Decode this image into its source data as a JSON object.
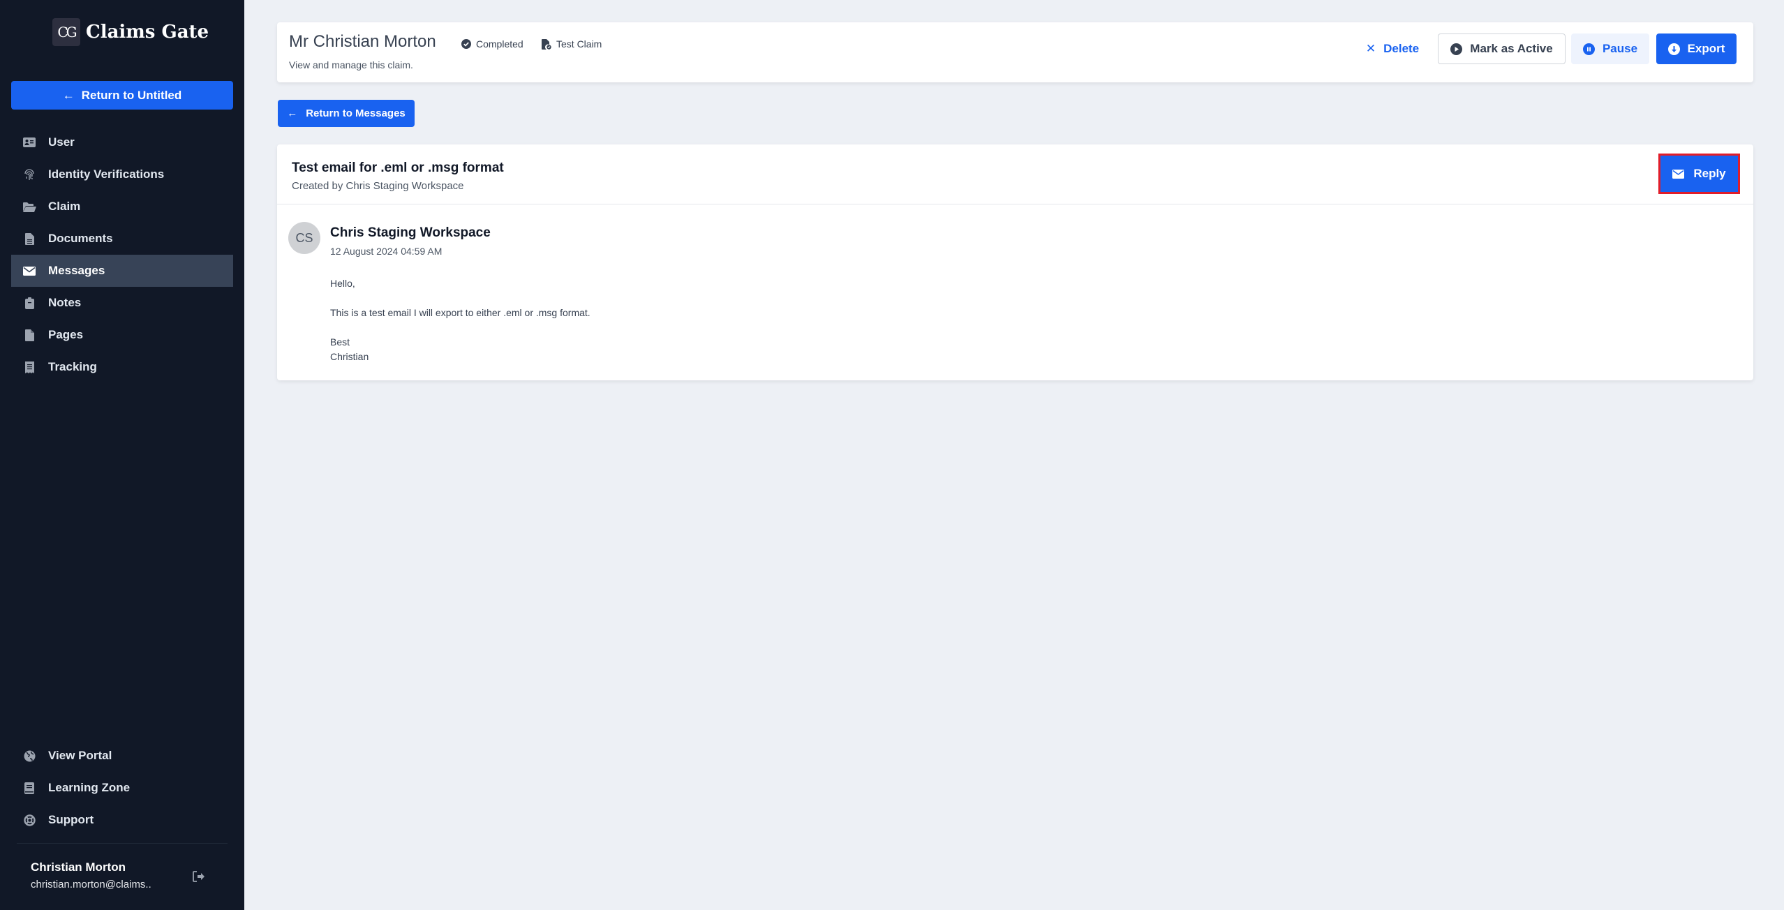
{
  "app": {
    "name": "Claims Gate",
    "logo_glyph": "CG"
  },
  "sidebar": {
    "return_button": "Return to Untitled",
    "items": [
      {
        "label": "User",
        "icon": "id-card-icon"
      },
      {
        "label": "Identity Verifications",
        "icon": "fingerprint-icon"
      },
      {
        "label": "Claim",
        "icon": "folder-open-icon"
      },
      {
        "label": "Documents",
        "icon": "file-lines-icon"
      },
      {
        "label": "Messages",
        "icon": "envelope-icon",
        "active": true
      },
      {
        "label": "Notes",
        "icon": "clipboard-icon"
      },
      {
        "label": "Pages",
        "icon": "file-icon"
      },
      {
        "label": "Tracking",
        "icon": "receipt-icon"
      }
    ],
    "bottom_items": [
      {
        "label": "View Portal",
        "icon": "globe-icon"
      },
      {
        "label": "Learning Zone",
        "icon": "book-icon"
      },
      {
        "label": "Support",
        "icon": "life-ring-icon"
      }
    ],
    "user": {
      "name": "Christian Morton",
      "email": "christian.morton@claims.."
    }
  },
  "header": {
    "title": "Mr Christian Morton",
    "status": "Completed",
    "claim_type": "Test Claim",
    "subtitle": "View and manage this claim.",
    "actions": {
      "delete": "Delete",
      "mark_active": "Mark as Active",
      "pause": "Pause",
      "export": "Export"
    }
  },
  "return_messages": "Return to Messages",
  "message": {
    "subject": "Test email for .eml or .msg format",
    "created_by": "Created by Chris Staging Workspace",
    "reply": "Reply",
    "sender_initials": "CS",
    "sender": "Chris Staging Workspace",
    "date": "12 August 2024 04:59 AM",
    "body": {
      "greeting": "Hello,",
      "line1": "This is a test email I will export to either .eml or .msg format.",
      "signoff": "Best",
      "signature": "Christian"
    }
  },
  "colors": {
    "primary": "#1962f0",
    "sidebar_bg": "#111827",
    "active_item": "#374357",
    "highlight": "#e11d2a"
  }
}
